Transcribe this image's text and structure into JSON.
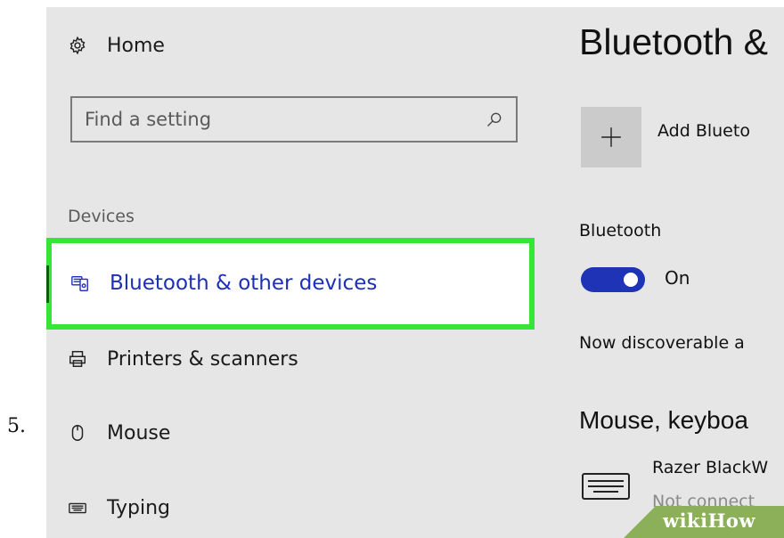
{
  "step_number": "5.",
  "sidebar": {
    "home_label": "Home",
    "search_placeholder": "Find a setting",
    "section_label": "Devices",
    "items": [
      {
        "label": "Bluetooth & other devices",
        "icon": "bluetooth-devices-icon",
        "selected": true
      },
      {
        "label": "Printers & scanners",
        "icon": "printer-icon"
      },
      {
        "label": "Mouse",
        "icon": "mouse-icon"
      },
      {
        "label": "Typing",
        "icon": "keyboard-icon"
      }
    ]
  },
  "content": {
    "title": "Bluetooth &",
    "add_label": "Add Blueto",
    "bluetooth_label": "Bluetooth",
    "toggle_label": "On",
    "toggle_on": true,
    "discoverable_text": "Now discoverable a",
    "subheading": "Mouse, keyboa",
    "device": {
      "name": "Razer BlackW",
      "status": "Not connect"
    }
  },
  "watermark": "wikiHow",
  "colors": {
    "accent": "#1e33b5",
    "selected_text": "#1d2fb8",
    "highlight_border": "#36e636",
    "background": "#e6e6e6"
  }
}
